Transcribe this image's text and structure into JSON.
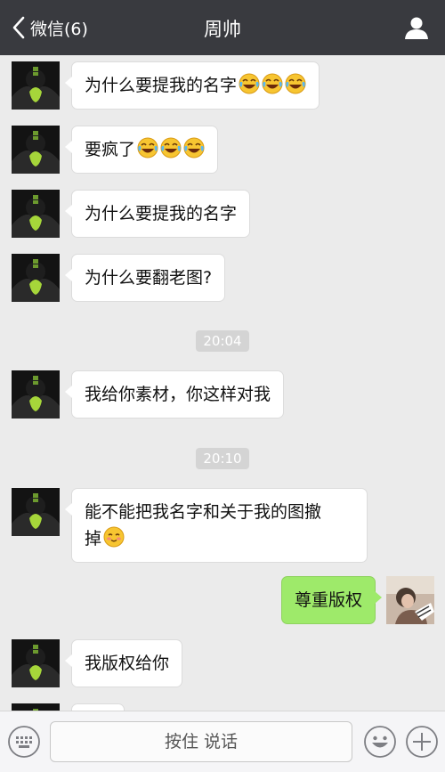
{
  "header": {
    "back_label": "微信(6)",
    "title": "周帅"
  },
  "messages": [
    {
      "text": "为什么要提我的名字",
      "emoji_count": 3
    },
    {
      "text": "要疯了",
      "emoji_count": 3
    },
    {
      "text": "为什么要提我的名字",
      "emoji_count": 0
    },
    {
      "text": "为什么要翻老图?",
      "emoji_count": 0
    },
    {
      "time": "20:04"
    },
    {
      "text": "我给你素材，你这样对我",
      "emoji_count": 0
    },
    {
      "time": "20:10"
    },
    {
      "text_line1": "能不能把我名字和关于我的图撤",
      "text_line2": "掉",
      "emoji_count": 1
    },
    {
      "text": "尊重版权",
      "sender": "self"
    },
    {
      "text": "我版权给你",
      "emoji_count": 0
    }
  ],
  "input": {
    "hold_to_talk_label": "按住 说话"
  },
  "icons": {
    "back": "chevron-left-icon",
    "profile": "person-icon",
    "keyboard": "keyboard-icon",
    "emoji": "smiley-icon",
    "plus": "plus-icon",
    "laugh_cry_emoji": "face-with-tears-of-joy-emoji",
    "blush_emoji": "smiling-face-emoji"
  },
  "colors": {
    "header_bg": "#393a3f",
    "chat_bg": "#ebebeb",
    "outgoing_bubble": "#9eea6a",
    "incoming_bubble": "#ffffff"
  }
}
